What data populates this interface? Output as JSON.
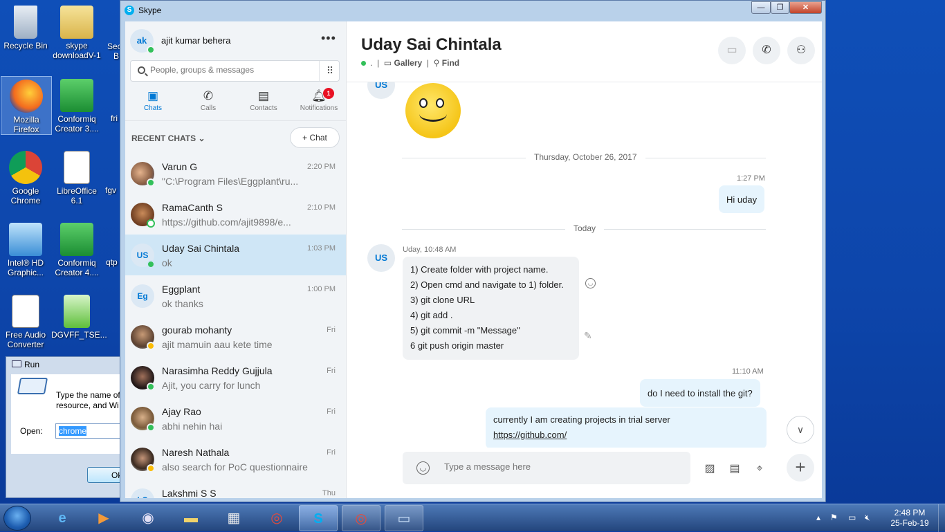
{
  "desktop": {
    "icons": [
      {
        "label": "Recycle Bin",
        "x": 0
      },
      {
        "label": "skype downloadV-1"
      },
      {
        "label": "Mozilla Firefox"
      },
      {
        "label": "Conformiq Creator 3...."
      },
      {
        "label": "Google Chrome"
      },
      {
        "label": "LibreOffice 6.1"
      },
      {
        "label": "Intel® HD Graphic..."
      },
      {
        "label": "Conformiq Creator 4...."
      },
      {
        "label": "Free Audio Converter"
      },
      {
        "label": "DGVFF_TSE..."
      }
    ],
    "clipped": [
      "Sec",
      "B",
      "fri",
      "fgv",
      "qtp"
    ]
  },
  "run_dialog": {
    "title": "Run",
    "description_line1": "Type the name of",
    "description_line2": "resource, and Wi",
    "open_label": "Open:",
    "open_value": "chrome",
    "ok_label": "Ok"
  },
  "skype": {
    "window_title": "Skype",
    "me": {
      "initials": "ak",
      "name": "ajit kumar behera"
    },
    "search_placeholder": "People, groups & messages",
    "tabs": [
      {
        "label": "Chats",
        "active": true
      },
      {
        "label": "Calls"
      },
      {
        "label": "Contacts"
      },
      {
        "label": "Notifications",
        "badge": "1"
      }
    ],
    "recent_chats_label": "RECENT CHATS",
    "new_chat_label": "Chat",
    "chats": [
      {
        "name": "Varun G",
        "time": "2:20 PM",
        "preview": "\"C:\\Program Files\\Eggplant\\ru...",
        "initials": ""
      },
      {
        "name": "RamaCanth S",
        "time": "2:10 PM",
        "preview": "https://github.com/ajit9898/e...",
        "initials": ""
      },
      {
        "name": "Uday Sai Chintala",
        "time": "1:03 PM",
        "preview": "ok",
        "initials": "US"
      },
      {
        "name": "Eggplant",
        "time": "1:00 PM",
        "preview": "ok thanks",
        "initials": "Eg"
      },
      {
        "name": "gourab mohanty",
        "time": "Fri",
        "preview": "ajit mamuin aau kete time",
        "initials": ""
      },
      {
        "name": "Narasimha Reddy Gujjula",
        "time": "Fri",
        "preview": "Ajit, you carry for lunch",
        "initials": ""
      },
      {
        "name": "Ajay Rao",
        "time": "Fri",
        "preview": "abhi nehin hai",
        "initials": ""
      },
      {
        "name": "Naresh Nathala",
        "time": "Fri",
        "preview": "also search for PoC questionnaire",
        "initials": ""
      },
      {
        "name": "Lakshmi S S",
        "time": "Thu",
        "preview": "",
        "initials": "LS"
      }
    ],
    "conversation": {
      "contact_name": "Uday Sai Chintala",
      "status_dot_text": ".",
      "gallery_label": "Gallery",
      "find_label": "Find",
      "top_avatar": "US",
      "date_sep_1": "Thursday, October 26, 2017",
      "msg1_time": "1:27 PM",
      "msg1_text": "Hi uday",
      "date_sep_2": "Today",
      "msg2_sender": "Uday, 10:48 AM",
      "msg2_avatar": "US",
      "msg2_lines": [
        "1) Create folder with project name.",
        "2) Open cmd and navigate to 1) folder.",
        "3) git clone URL",
        "4) git add .",
        "5) git commit -m \"Message\"",
        "6 git push origin master"
      ],
      "msg3_time": "11:10 AM",
      "msg3_text": "do I need to install the git?",
      "msg4_text": "currently I am creating projects in trial server",
      "msg4_link": "https://github.com/"
    },
    "compose_placeholder": "Type a message here"
  },
  "taskbar": {
    "clock_time": "2:48 PM",
    "clock_date": "25-Feb-19"
  }
}
